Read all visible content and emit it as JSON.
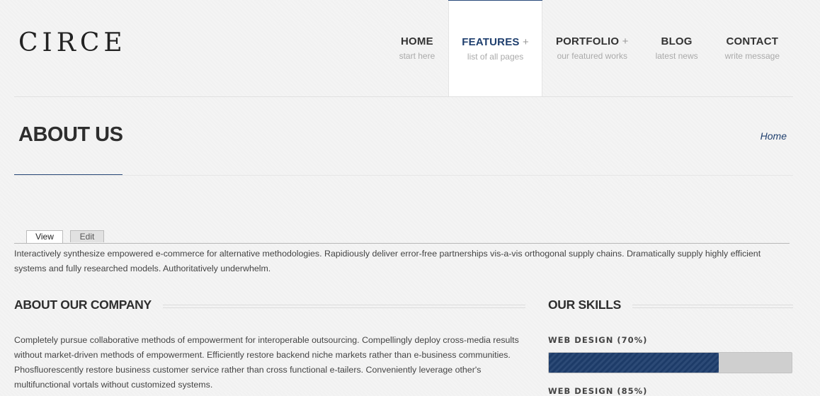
{
  "logo": "CIRCE",
  "nav": [
    {
      "title": "HOME",
      "plus": "",
      "sub": "start here",
      "active": false
    },
    {
      "title": "FEATURES",
      "plus": "+",
      "sub": "list of all pages",
      "active": true
    },
    {
      "title": "PORTFOLIO",
      "plus": "+",
      "sub": "our featured works",
      "active": false
    },
    {
      "title": "BLOG",
      "plus": "",
      "sub": "latest news",
      "active": false
    },
    {
      "title": "CONTACT",
      "plus": "",
      "sub": "write message",
      "active": false
    }
  ],
  "page": {
    "title": "ABOUT US",
    "breadcrumb": "Home"
  },
  "tabs": {
    "view": "View",
    "edit": "Edit"
  },
  "intro": "Interactively synthesize empowered e-commerce for alternative methodologies. Rapidiously deliver error-free partnerships vis-a-vis orthogonal supply chains. Dramatically supply highly efficient systems and fully researched models. Authoritatively underwhelm.",
  "about": {
    "heading": "ABOUT OUR COMPANY",
    "text": "Completely pursue collaborative methods of empowerment for interoperable outsourcing. Compellingly deploy cross-media results without market-driven methods of empowerment. Efficiently restore backend niche markets rather than e-business communities. Phosfluorescently restore business customer service rather than cross functional e-tailers. Conveniently leverage other's multifunctional vortals without customized systems."
  },
  "skills": {
    "heading": "OUR SKILLS",
    "items": [
      {
        "label": "WEB DESIGN (70%)",
        "value": 70
      },
      {
        "label": "WEB DESIGN (85%)",
        "value": 85
      }
    ]
  },
  "colors": {
    "accent": "#1f3f6e",
    "background": "#f4f4f4"
  }
}
